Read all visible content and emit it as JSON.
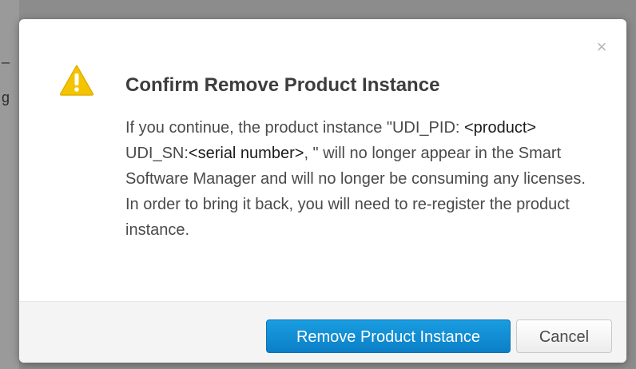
{
  "background": {
    "fragment_1": "_",
    "fragment_2": "g"
  },
  "dialog": {
    "title": "Confirm Remove Product Instance",
    "close_glyph": "×",
    "icon": "warning-triangle-icon",
    "message": {
      "part1": "If you continue, the product instance \"UDI_PID: ",
      "product_placeholder": "<product>",
      "part2": " UDI_SN:",
      "serial_placeholder": "<serial number>",
      "part3": ", \" will no longer appear in the Smart Software Manager and will no longer be consuming any licenses. In order to bring it back, you will need to re-register the product instance."
    },
    "buttons": {
      "confirm_label": "Remove Product Instance",
      "cancel_label": "Cancel"
    }
  },
  "colors": {
    "primary": "#0b7fc7",
    "warning": "#f5c400",
    "title_text": "#3d3d3d",
    "body_text": "#4a4a4a"
  }
}
